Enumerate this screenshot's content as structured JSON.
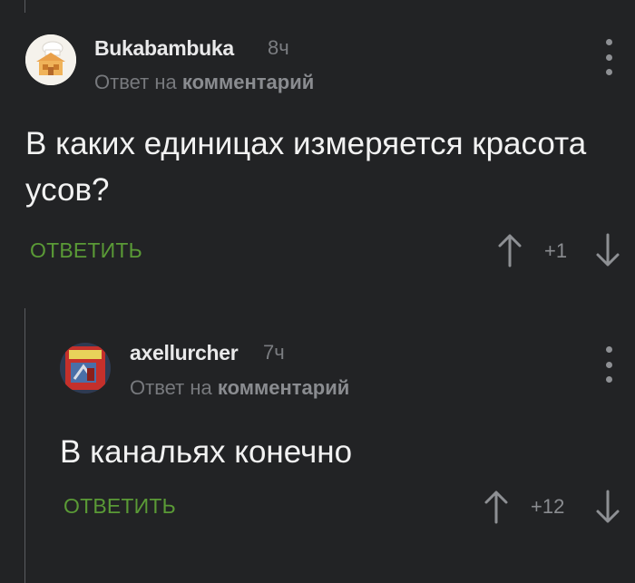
{
  "comments": [
    {
      "username": "Bukabambuka",
      "time": "8ч",
      "reply_prefix": "Ответ на",
      "reply_target": "комментарий",
      "text": "В каких единицах измеряется красота усов?",
      "reply_label": "ОТВЕТИТЬ",
      "score": "+1",
      "avatar_icon": "cook-house-avatar"
    },
    {
      "username": "axellurcher",
      "time": "7ч",
      "reply_prefix": "Ответ на",
      "reply_target": "комментарий",
      "text": "В канальях конечно",
      "reply_label": "ОТВЕТИТЬ",
      "score": "+12",
      "avatar_icon": "book-cover-avatar"
    }
  ],
  "colors": {
    "background": "#222325",
    "reply_button": "#5a9a36",
    "muted_text": "#77797d"
  }
}
